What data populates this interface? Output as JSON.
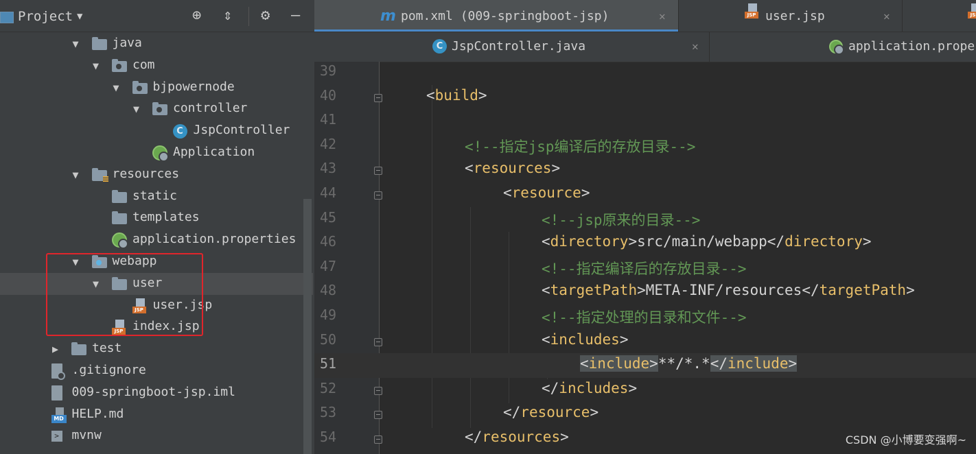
{
  "project_panel": {
    "title": "Project",
    "tree": [
      {
        "label": "java",
        "depth": 1,
        "icon": "folder-icon",
        "expanded": true
      },
      {
        "label": "com",
        "depth": 2,
        "icon": "package-icon",
        "expanded": true
      },
      {
        "label": "bjpowernode",
        "depth": 3,
        "icon": "package-icon",
        "expanded": true
      },
      {
        "label": "controller",
        "depth": 4,
        "icon": "package-icon",
        "expanded": true
      },
      {
        "label": "JspController",
        "depth": 5,
        "icon": "java-class-icon"
      },
      {
        "label": "Application",
        "depth": 4,
        "icon": "spring-boot-app-icon"
      },
      {
        "label": "resources",
        "depth": 1,
        "icon": "resources-folder-icon",
        "expanded": true
      },
      {
        "label": "static",
        "depth": 2,
        "icon": "folder-icon"
      },
      {
        "label": "templates",
        "depth": 2,
        "icon": "folder-icon"
      },
      {
        "label": "application.properties",
        "depth": 2,
        "icon": "spring-properties-icon"
      },
      {
        "label": "webapp",
        "depth": 1,
        "icon": "web-folder-icon",
        "expanded": true
      },
      {
        "label": "user",
        "depth": 2,
        "icon": "folder-icon",
        "expanded": true,
        "selected": true
      },
      {
        "label": "user.jsp",
        "depth": 3,
        "icon": "jsp-file-icon"
      },
      {
        "label": "index.jsp",
        "depth": 2,
        "icon": "jsp-file-icon"
      },
      {
        "label": "test",
        "depth": 0,
        "icon": "folder-icon",
        "expanded": false
      },
      {
        "label": ".gitignore",
        "depth": -1,
        "icon": "gitignore-file-icon"
      },
      {
        "label": "009-springboot-jsp.iml",
        "depth": -1,
        "icon": "iml-file-icon"
      },
      {
        "label": "HELP.md",
        "depth": -1,
        "icon": "markdown-file-icon"
      },
      {
        "label": "mvnw",
        "depth": -1,
        "icon": "shell-file-icon"
      }
    ]
  },
  "editor": {
    "tabs_row1": [
      {
        "label": "pom.xml (009-springboot-jsp)",
        "active": true
      },
      {
        "label": "user.jsp",
        "active": false
      }
    ],
    "tabs_row2": [
      {
        "label": "JspController.java",
        "active": false
      },
      {
        "label": "application.proper",
        "active": false
      }
    ],
    "current_line": 51,
    "lines": [
      {
        "num": "39",
        "indent": 0,
        "parts": []
      },
      {
        "num": "40",
        "indent": 1,
        "parts": [
          {
            "t": "br",
            "v": "<"
          },
          {
            "t": "tg",
            "v": "build"
          },
          {
            "t": "br",
            "v": ">"
          }
        ]
      },
      {
        "num": "41",
        "indent": 0,
        "parts": []
      },
      {
        "num": "42",
        "indent": 2,
        "parts": [
          {
            "t": "cm",
            "v": "<!--指定jsp编译后的存放目录-->"
          }
        ]
      },
      {
        "num": "43",
        "indent": 2,
        "parts": [
          {
            "t": "br",
            "v": "<"
          },
          {
            "t": "tg",
            "v": "resources"
          },
          {
            "t": "br",
            "v": ">"
          }
        ]
      },
      {
        "num": "44",
        "indent": 3,
        "parts": [
          {
            "t": "br",
            "v": "<"
          },
          {
            "t": "tg",
            "v": "resource"
          },
          {
            "t": "br",
            "v": ">"
          }
        ]
      },
      {
        "num": "45",
        "indent": 4,
        "parts": [
          {
            "t": "cm",
            "v": "<!--jsp原来的目录-->"
          }
        ]
      },
      {
        "num": "46",
        "indent": 4,
        "parts": [
          {
            "t": "br",
            "v": "<"
          },
          {
            "t": "tg",
            "v": "directory"
          },
          {
            "t": "br",
            "v": ">"
          },
          {
            "t": "tx",
            "v": "src/main/webapp"
          },
          {
            "t": "br",
            "v": "</"
          },
          {
            "t": "tg",
            "v": "directory"
          },
          {
            "t": "br",
            "v": ">"
          }
        ]
      },
      {
        "num": "47",
        "indent": 4,
        "parts": [
          {
            "t": "cm",
            "v": "<!--指定编译后的存放目录-->"
          }
        ]
      },
      {
        "num": "48",
        "indent": 4,
        "parts": [
          {
            "t": "br",
            "v": "<"
          },
          {
            "t": "tg",
            "v": "targetPath"
          },
          {
            "t": "br",
            "v": ">"
          },
          {
            "t": "tx",
            "v": "META-INF/resources"
          },
          {
            "t": "br",
            "v": "</"
          },
          {
            "t": "tg",
            "v": "targetPath"
          },
          {
            "t": "br",
            "v": ">"
          }
        ]
      },
      {
        "num": "49",
        "indent": 4,
        "parts": [
          {
            "t": "cm",
            "v": "<!--指定处理的目录和文件-->"
          }
        ]
      },
      {
        "num": "50",
        "indent": 4,
        "parts": [
          {
            "t": "br",
            "v": "<"
          },
          {
            "t": "tg",
            "v": "includes"
          },
          {
            "t": "br",
            "v": ">"
          }
        ]
      },
      {
        "num": "51",
        "indent": 5,
        "parts": [
          {
            "t": "br hl",
            "v": "<"
          },
          {
            "t": "tg hl",
            "v": "include"
          },
          {
            "t": "br hl",
            "v": ">"
          },
          {
            "t": "tx",
            "v": "**/*.*"
          },
          {
            "t": "br hl",
            "v": "</"
          },
          {
            "t": "tg hl",
            "v": "include"
          },
          {
            "t": "br hl",
            "v": ">"
          }
        ]
      },
      {
        "num": "52",
        "indent": 4,
        "parts": [
          {
            "t": "br",
            "v": "</"
          },
          {
            "t": "tg",
            "v": "includes"
          },
          {
            "t": "br",
            "v": ">"
          }
        ]
      },
      {
        "num": "53",
        "indent": 3,
        "parts": [
          {
            "t": "br",
            "v": "</"
          },
          {
            "t": "tg",
            "v": "resource"
          },
          {
            "t": "br",
            "v": ">"
          }
        ]
      },
      {
        "num": "54",
        "indent": 2,
        "parts": [
          {
            "t": "br",
            "v": "</"
          },
          {
            "t": "tg",
            "v": "resources"
          },
          {
            "t": "br",
            "v": ">"
          }
        ]
      }
    ]
  },
  "watermark": "CSDN @小博要变强啊~",
  "colors": {
    "tag": "#e8bf6a",
    "comment": "#629755",
    "text": "#a9b7c6",
    "highlight_box": "#e0252b",
    "active_tab_underline": "#4a88c7"
  }
}
